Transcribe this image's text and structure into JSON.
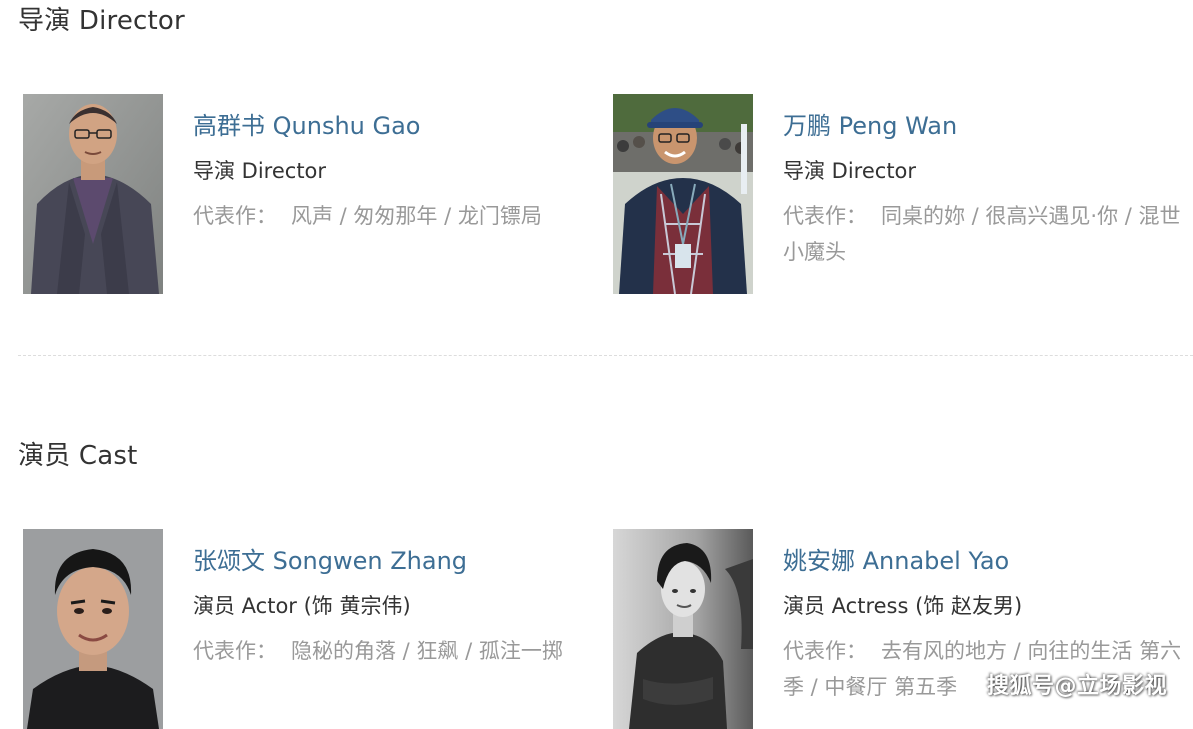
{
  "directors": {
    "title": "导演 Director",
    "people": [
      {
        "name": "高群书 Qunshu Gao",
        "role": "导演 Director",
        "works_prefix": "代表作：",
        "works": "风声 / 匆匆那年 / 龙门镖局"
      },
      {
        "name": "万鹏 Peng Wan",
        "role": "导演 Director",
        "works_prefix": "代表作：",
        "works": "同桌的妳 / 很高兴遇见·你 / 混世小魔头"
      }
    ]
  },
  "cast": {
    "title": "演员 Cast",
    "people": [
      {
        "name": "张颂文 Songwen Zhang",
        "role": "演员 Actor (饰 黄宗伟)",
        "works_prefix": "代表作：",
        "works": "隐秘的角落 / 狂飙 / 孤注一掷"
      },
      {
        "name": "姚安娜 Annabel Yao",
        "role": "演员 Actress (饰 赵友男)",
        "works_prefix": "代表作：",
        "works": "去有风的地方 / 向往的生活 第六季 / 中餐厅 第五季"
      }
    ]
  },
  "watermark": "搜狐号@立场影视",
  "colors": {
    "name_link": "#3d6e94",
    "text": "#333333",
    "muted": "#999999"
  }
}
